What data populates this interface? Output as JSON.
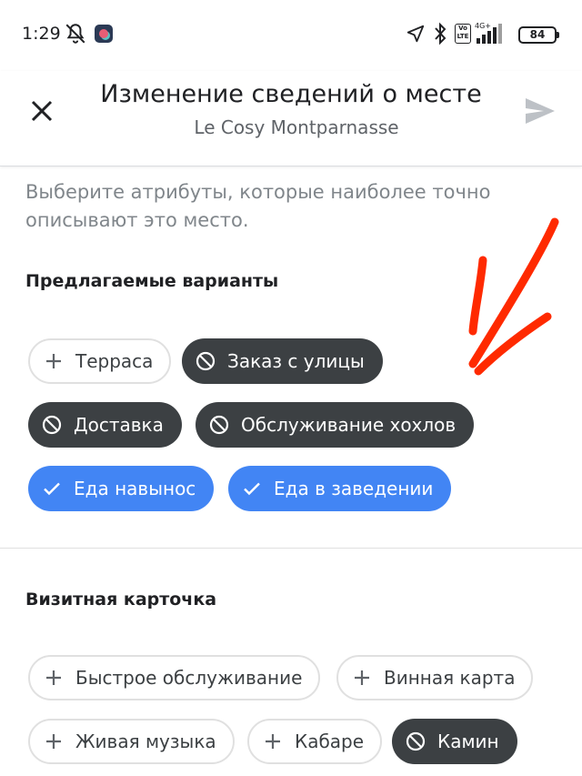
{
  "status_bar": {
    "time": "1:29",
    "network": "4G+",
    "volte": "Vo LTE",
    "battery": "84"
  },
  "header": {
    "title": "Изменение сведений о месте",
    "subtitle": "Le Cosy Montparnasse",
    "close_icon": "close-icon",
    "send_icon": "send-icon"
  },
  "intro_text": "Выберите атрибуты, которые наиболее точно описывают это место.",
  "sections": [
    {
      "title": "Предлагаемые варианты",
      "chips": [
        {
          "label": "Терраса",
          "state": "add",
          "icon": "plus-icon"
        },
        {
          "label": "Заказ с улицы",
          "state": "no",
          "icon": "block-icon"
        },
        {
          "label": "Доставка",
          "state": "no",
          "icon": "block-icon"
        },
        {
          "label": "Обслуживание хохлов",
          "state": "no",
          "icon": "block-icon"
        },
        {
          "label": "Еда навынос",
          "state": "yes",
          "icon": "check-icon"
        },
        {
          "label": "Еда в заведении",
          "state": "yes",
          "icon": "check-icon"
        }
      ]
    },
    {
      "title": "Визитная карточка",
      "chips": [
        {
          "label": "Быстрое обслуживание",
          "state": "add",
          "icon": "plus-icon"
        },
        {
          "label": "Винная карта",
          "state": "add",
          "icon": "plus-icon"
        },
        {
          "label": "Живая музыка",
          "state": "add",
          "icon": "plus-icon"
        },
        {
          "label": "Кабаре",
          "state": "add",
          "icon": "plus-icon"
        },
        {
          "label": "Камин",
          "state": "no",
          "icon": "block-icon"
        }
      ]
    }
  ],
  "colors": {
    "selected_yes": "#4285f4",
    "selected_no": "#3c4043",
    "chip_border": "#e0e0e0",
    "annotation": "#ff2a00"
  }
}
